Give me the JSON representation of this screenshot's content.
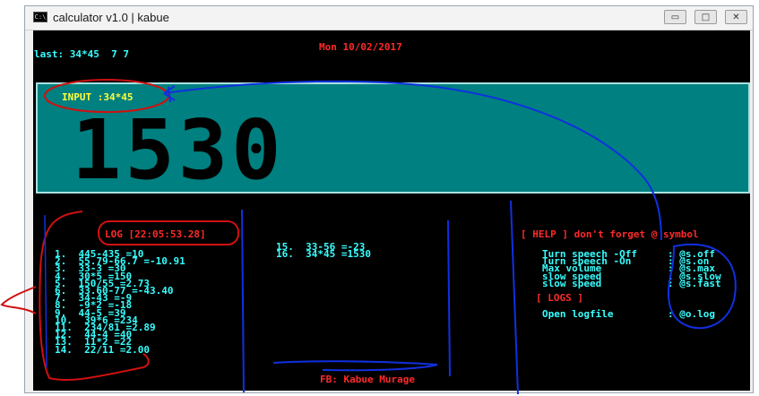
{
  "window": {
    "title": "calculator v1.0 | kabue",
    "icon": "cmd-icon",
    "icon_text": "C:\\",
    "controls": {
      "minimize": "▭",
      "maximize": "□",
      "close": "✕"
    }
  },
  "header": {
    "last_label": "last: 34*45  7 7",
    "date": "Mon 10/02/2017"
  },
  "display": {
    "input_label": "INPUT :34*45",
    "result": "1530"
  },
  "log": {
    "title": "LOG [22:05:53.28]",
    "items": [
      "1.  445-435 =10",
      "2.  55.79-66.7 =-10.91",
      "3.  33-3 =30",
      "4.  30*5 =150",
      "5.  150/55 =2.73",
      "6.  33.60-77 =-43.40",
      "7.  34-43 =-9",
      "8.  -9*2 =-18",
      "9.  44-5 =39",
      "10.  39*6 =234",
      "11.  234/81 =2.89",
      "12.  44-4 =40",
      "13.  11*2 =22",
      "14.  22/11 =2.00"
    ],
    "items_col2": [
      "15.  33-56 =-23",
      "16.  34*45 =1530"
    ]
  },
  "help": {
    "title": "[ HELP ] don't forget @ symbol",
    "commands": [
      {
        "label": "Turn speech -Off",
        "cmd": ": @s.off"
      },
      {
        "label": "Turn speech -On",
        "cmd": ": @s.on"
      },
      {
        "label": "Max volume",
        "cmd": ": @s.max"
      },
      {
        "label": "slow speed",
        "cmd": ": @s.slow"
      },
      {
        "label": "slow speed",
        "cmd": ": @s.fast"
      }
    ],
    "logs_title": "[ LOGS ]",
    "log_commands": [
      {
        "label": "Open logfile",
        "cmd": ": @o.log"
      }
    ]
  },
  "footer": {
    "credit": "FB: Kabue Murage"
  },
  "colors": {
    "console_bg": "#000000",
    "panel_bg": "#008080",
    "cyan_text": "#38ffff",
    "red_text": "#ff2a2a",
    "yellow_text": "#ffff40",
    "annotation_blue": "#1030e0",
    "annotation_red": "#d01010"
  }
}
